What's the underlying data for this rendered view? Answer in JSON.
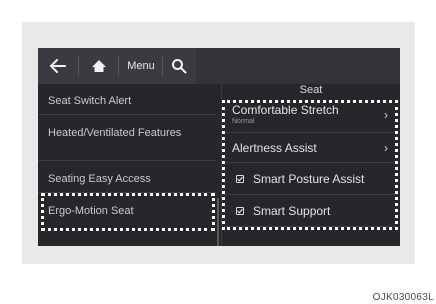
{
  "topbar": {
    "back_icon": "arrow-left-icon",
    "home_icon": "home-icon",
    "menu_label": "Menu",
    "search_icon": "search-icon"
  },
  "left_list": {
    "items": [
      {
        "label": "Seat Switch Alert"
      },
      {
        "label": "Heated/Ventilated Features"
      },
      {
        "label": "Seating Easy Access"
      },
      {
        "label": "Ergo-Motion Seat"
      }
    ]
  },
  "right_panel": {
    "title": "Seat",
    "items": [
      {
        "label": "Comfortable Stretch",
        "sub": "Normal",
        "type": "submenu"
      },
      {
        "label": "Alertness Assist",
        "type": "submenu"
      },
      {
        "label": "Smart Posture Assist",
        "type": "checkbox",
        "checked": true
      },
      {
        "label": "Smart Support",
        "type": "checkbox",
        "checked": true
      }
    ]
  },
  "figure_code": "OJK030063L",
  "colors": {
    "screen_bg": "#26272b",
    "highlight": "#ffffff"
  }
}
